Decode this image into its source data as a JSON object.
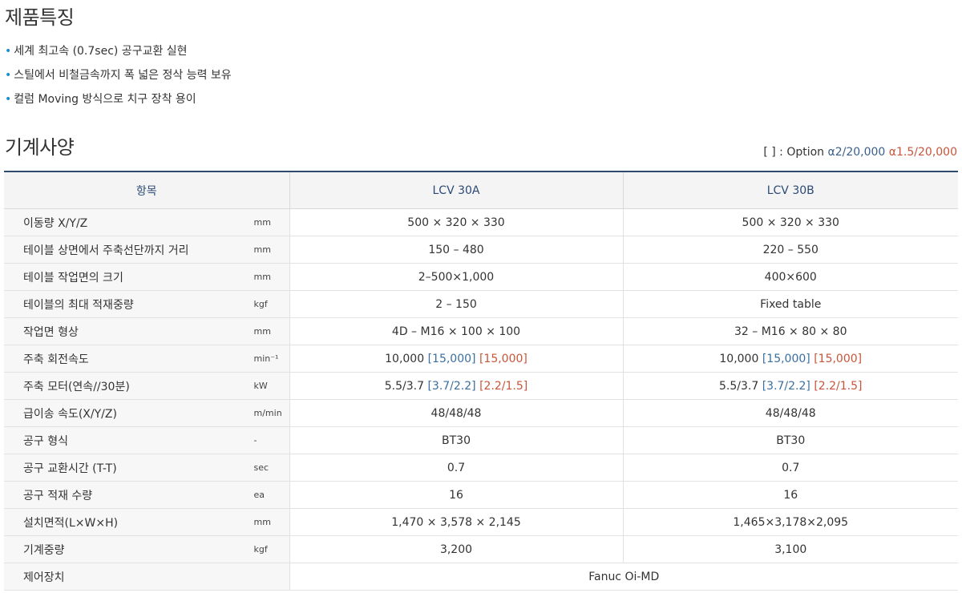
{
  "features": {
    "title": "제품특징",
    "items": [
      "세계 최고속 (0.7sec) 공구교환 실현",
      "스틸에서 비철금속까지 폭 넓은 정삭 능력 보유",
      "컬럼 Moving 방식으로 치구 장착 용이"
    ]
  },
  "spec": {
    "title": "기계사양",
    "legend": {
      "prefix": "[ ] : Option",
      "opt1": "α2/20,000",
      "opt2": "α1.5/20,000",
      "opt1_color": "#3a5f8c",
      "opt2_color": "#c8553a"
    },
    "headers": [
      "항목",
      "LCV 30A",
      "LCV 30B"
    ],
    "rows": [
      {
        "label": "이동량 X/Y/Z",
        "unit": "mm",
        "a": {
          "base": "500 × 320 × 330"
        },
        "b": {
          "base": "500 × 320 × 330"
        }
      },
      {
        "label": "테이블 상면에서 주축선단까지 거리",
        "unit": "mm",
        "a": {
          "base": "150 – 480"
        },
        "b": {
          "base": "220 – 550"
        }
      },
      {
        "label": "테이블 작업면의 크기",
        "unit": "mm",
        "a": {
          "base": "2–500×1,000"
        },
        "b": {
          "base": "400×600"
        }
      },
      {
        "label": "테이블의 최대 적재중량",
        "unit": "kgf",
        "a": {
          "base": "2 – 150"
        },
        "b": {
          "base": "Fixed table"
        }
      },
      {
        "label": "작업면 형상",
        "unit": "mm",
        "a": {
          "base": "4D – M16 × 100 × 100"
        },
        "b": {
          "base": "32 – M16 × 80 × 80"
        }
      },
      {
        "label": "주축 회전속도",
        "unit": "min⁻¹",
        "a": {
          "base": "10,000",
          "opt1": "[15,000]",
          "opt2": "[15,000]"
        },
        "b": {
          "base": "10,000",
          "opt1": "[15,000]",
          "opt2": "[15,000]"
        }
      },
      {
        "label": "주축 모터(연속//30분)",
        "unit": "kW",
        "a": {
          "base": "5.5/3.7",
          "opt1": "[3.7/2.2]",
          "opt2": "[2.2/1.5]"
        },
        "b": {
          "base": "5.5/3.7",
          "opt1": "[3.7/2.2]",
          "opt2": "[2.2/1.5]"
        }
      },
      {
        "label": "급이송 속도(X/Y/Z)",
        "unit": "m/min",
        "a": {
          "base": "48/48/48"
        },
        "b": {
          "base": "48/48/48"
        }
      },
      {
        "label": "공구 형식",
        "unit": "-",
        "a": {
          "base": "BT30"
        },
        "b": {
          "base": "BT30"
        }
      },
      {
        "label": "공구 교환시간 (T-T)",
        "unit": "sec",
        "a": {
          "base": "0.7"
        },
        "b": {
          "base": "0.7"
        }
      },
      {
        "label": "공구 적재 수량",
        "unit": "ea",
        "a": {
          "base": "16"
        },
        "b": {
          "base": "16"
        }
      },
      {
        "label": "설치면적(L×W×H)",
        "unit": "mm",
        "a": {
          "base": "1,470 × 3,578 × 2,145"
        },
        "b": {
          "base": "1,465×3,178×2,095"
        }
      }
    ],
    "weight_row": {
      "label": "기계중량",
      "unit": "kgf",
      "a": "3,200",
      "b": "3,100"
    },
    "control_row": {
      "label": "제어장치",
      "value": "Fanuc Oi-MD"
    }
  }
}
